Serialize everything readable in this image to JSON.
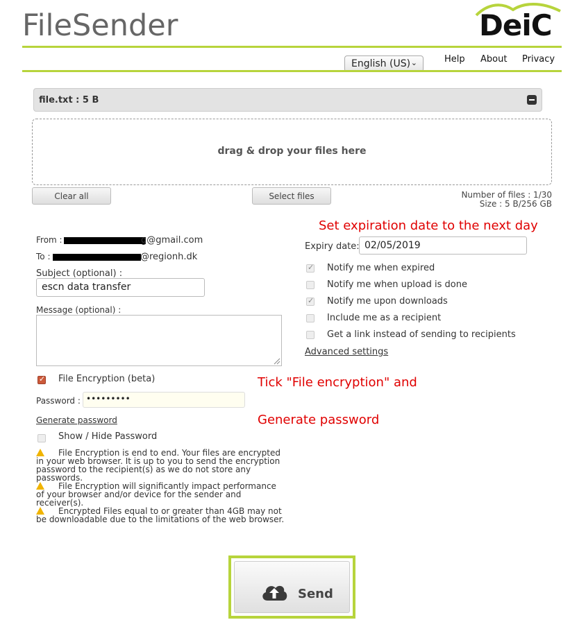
{
  "header": {
    "app_title": "FileSender",
    "brand": "DeiC",
    "language": "English (US)",
    "nav": [
      "Help",
      "About",
      "Privacy"
    ]
  },
  "file_bar": {
    "name": "file.txt : 5 B"
  },
  "dropzone": {
    "text": "drag & drop your files here"
  },
  "buttons": {
    "clear_all": "Clear all",
    "select_files": "Select files",
    "send": "Send"
  },
  "stats": {
    "files": "Number of files : 1/30",
    "size": "Size : 5 B/256 GB"
  },
  "form": {
    "from_label": "From :",
    "from_suffix": "g@gmail.com",
    "to_label": "To :",
    "to_suffix": "@regionh.dk",
    "subject_label": "Subject (optional) :",
    "subject_value": "escn data transfer",
    "message_label": "Message (optional) :",
    "encryption_label": "File Encryption (beta)",
    "password_label": "Password :",
    "password_value": "•••••••••",
    "generate_password": "Generate password",
    "show_hide": "Show / Hide Password"
  },
  "expiry": {
    "label": "Expiry date:",
    "value": "02/05/2019"
  },
  "options": [
    {
      "label": "Notify me when expired",
      "checked": true
    },
    {
      "label": "Notify me when upload is done",
      "checked": false
    },
    {
      "label": "Notify me upon downloads",
      "checked": true
    },
    {
      "label": "Include me as a recipient",
      "checked": false
    },
    {
      "label": "Get a link instead of sending to recipients",
      "checked": false
    }
  ],
  "advanced_settings": "Advanced settings",
  "warnings": [
    "File Encryption is end to end. Your files are encrypted in your web browser. It is up to you to send the encryption password to the recipient(s) as we do not store any passwords.",
    "File Encryption will significantly impact performance of your browser and/or device for the sender and receiver(s).",
    "Encrypted Files equal to or greater than 4GB may not be downloadable due to the limitations of the web browser."
  ],
  "annotations": {
    "expiry": "Set expiration date to the next day",
    "encrypt": "Tick \"File encryption\" and",
    "generate": "Generate password"
  },
  "colors": {
    "accent": "#b7d43c",
    "annotation": "#e00000",
    "warning": "#f0b400"
  }
}
